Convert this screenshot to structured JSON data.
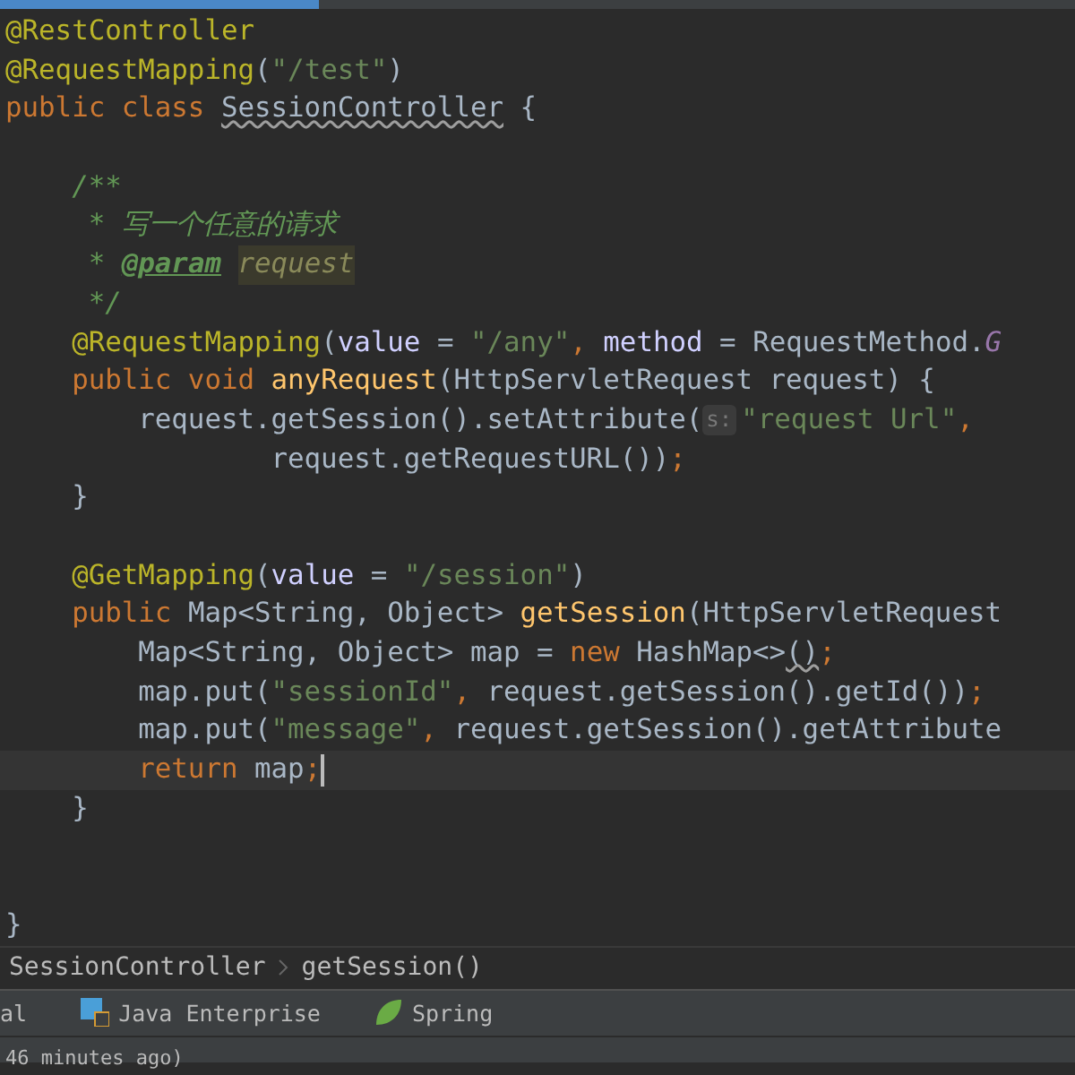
{
  "editor_tabs": [
    {
      "selected": true
    }
  ],
  "editor": {
    "lines": [
      {
        "current": false,
        "tokens": [
          {
            "kind": "anno",
            "text": "@RestController"
          }
        ]
      },
      {
        "current": false,
        "tokens": [
          {
            "kind": "anno",
            "text": "@RequestMapping"
          },
          {
            "kind": "plain",
            "text": "("
          },
          {
            "kind": "str",
            "text": "\"/test\""
          },
          {
            "kind": "plain",
            "text": ")"
          }
        ]
      },
      {
        "current": false,
        "tokens": [
          {
            "kind": "kw",
            "text": "public class "
          },
          {
            "kind": "warn",
            "text": "SessionController"
          },
          {
            "kind": "plain",
            "text": " {"
          }
        ]
      },
      {
        "kind": "blank"
      },
      {
        "current": false,
        "tokens": [
          {
            "kind": "doc",
            "text": "    /**"
          }
        ]
      },
      {
        "current": false,
        "tokens": [
          {
            "kind": "doc",
            "text": "     * 写一个任意的请求"
          }
        ]
      },
      {
        "current": false,
        "tokens": [
          {
            "kind": "doc",
            "text": "     * "
          },
          {
            "kind": "doctag",
            "text": "@param "
          },
          {
            "kind": "docparam",
            "text": "request"
          }
        ]
      },
      {
        "current": false,
        "tokens": [
          {
            "kind": "doc",
            "text": "     */"
          }
        ]
      },
      {
        "current": false,
        "tokens": [
          {
            "kind": "anno",
            "text": "    @RequestMapping"
          },
          {
            "kind": "plain",
            "text": "("
          },
          {
            "kind": "attr",
            "text": "value"
          },
          {
            "kind": "plain",
            "text": " = "
          },
          {
            "kind": "str",
            "text": "\"/any\""
          },
          {
            "kind": "kw",
            "text": ", "
          },
          {
            "kind": "attr",
            "text": "method"
          },
          {
            "kind": "plain",
            "text": " = RequestMethod."
          },
          {
            "kind": "field",
            "text": "G"
          }
        ]
      },
      {
        "current": false,
        "tokens": [
          {
            "kind": "kw",
            "text": "    public void "
          },
          {
            "kind": "decl",
            "text": "anyRequest"
          },
          {
            "kind": "plain",
            "text": "(HttpServletRequest request) {"
          }
        ]
      },
      {
        "current": false,
        "tokens": [
          {
            "kind": "plain",
            "text": "        request.getSession().setAttribute("
          },
          {
            "kind": "hint",
            "text": "s:"
          },
          {
            "kind": "str",
            "text": "\"request Url\""
          },
          {
            "kind": "kw",
            "text": ","
          }
        ]
      },
      {
        "current": false,
        "tokens": [
          {
            "kind": "plain",
            "text": "                request.getRequestURL())"
          },
          {
            "kind": "kw",
            "text": ";"
          }
        ]
      },
      {
        "current": false,
        "tokens": [
          {
            "kind": "plain",
            "text": "    }"
          }
        ]
      },
      {
        "kind": "blank"
      },
      {
        "current": false,
        "tokens": [
          {
            "kind": "anno",
            "text": "    @GetMapping"
          },
          {
            "kind": "plain",
            "text": "("
          },
          {
            "kind": "attr",
            "text": "value"
          },
          {
            "kind": "plain",
            "text": " = "
          },
          {
            "kind": "str",
            "text": "\"/session\""
          },
          {
            "kind": "plain",
            "text": ")"
          }
        ]
      },
      {
        "current": false,
        "tokens": [
          {
            "kind": "kw",
            "text": "    public "
          },
          {
            "kind": "plain",
            "text": "Map<String, Object> "
          },
          {
            "kind": "decl",
            "text": "getSession"
          },
          {
            "kind": "plain",
            "text": "(HttpServletRequest"
          }
        ]
      },
      {
        "current": false,
        "tokens": [
          {
            "kind": "plain",
            "text": "        Map<String, Object> map = "
          },
          {
            "kind": "kw",
            "text": "new "
          },
          {
            "kind": "plain",
            "text": "HashMap<>"
          },
          {
            "kind": "warn",
            "text": "()"
          },
          {
            "kind": "kw",
            "text": ";"
          }
        ]
      },
      {
        "current": false,
        "tokens": [
          {
            "kind": "plain",
            "text": "        map.put("
          },
          {
            "kind": "str",
            "text": "\"sessionId\""
          },
          {
            "kind": "kw",
            "text": ", "
          },
          {
            "kind": "plain",
            "text": "request.getSession().getId())"
          },
          {
            "kind": "kw",
            "text": ";"
          }
        ]
      },
      {
        "current": false,
        "tokens": [
          {
            "kind": "plain",
            "text": "        map.put("
          },
          {
            "kind": "str",
            "text": "\"message\""
          },
          {
            "kind": "kw",
            "text": ", "
          },
          {
            "kind": "plain",
            "text": "request.getSession().getAttribute"
          }
        ]
      },
      {
        "current": true,
        "tokens": [
          {
            "kind": "kw",
            "text": "        return "
          },
          {
            "kind": "plain",
            "text": "map"
          },
          {
            "kind": "kw",
            "text": ";"
          }
        ]
      },
      {
        "current": false,
        "tokens": [
          {
            "kind": "plain",
            "text": "    }"
          }
        ]
      },
      {
        "kind": "blank"
      },
      {
        "kind": "blank"
      },
      {
        "current": false,
        "tokens": [
          {
            "kind": "plain",
            "text": "}"
          }
        ]
      }
    ]
  },
  "breadcrumbs": [
    "SessionController",
    "getSession()"
  ],
  "tool_windows": [
    {
      "kind": "plain",
      "label": "al"
    },
    {
      "kind": "javaee",
      "label": "Java Enterprise"
    },
    {
      "kind": "spring",
      "label": "Spring"
    }
  ],
  "status_bar": {
    "text": "46 minutes ago)"
  }
}
